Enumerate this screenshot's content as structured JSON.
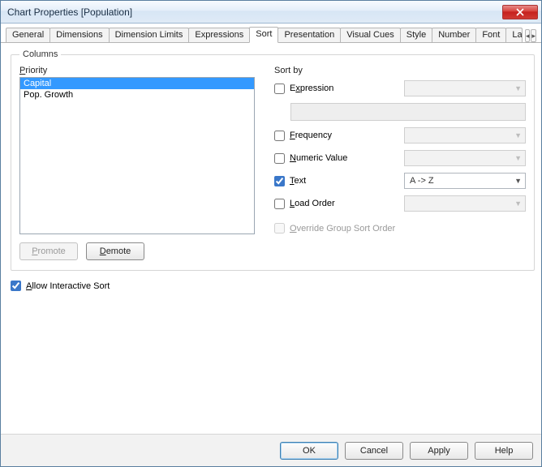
{
  "window": {
    "title": "Chart Properties [Population]"
  },
  "tabs": {
    "items": [
      "General",
      "Dimensions",
      "Dimension Limits",
      "Expressions",
      "Sort",
      "Presentation",
      "Visual Cues",
      "Style",
      "Number",
      "Font",
      "Layo"
    ],
    "activeIndex": 4
  },
  "columns": {
    "legend": "Columns",
    "priority_label": "Priority",
    "priority_items": [
      "Capital",
      "Pop. Growth"
    ],
    "selectedIndex": 0,
    "promote_label": "Promote",
    "demote_label": "Demote"
  },
  "sortby": {
    "label": "Sort by",
    "expression": {
      "label_pre": "E",
      "label_u": "x",
      "label_post": "pression",
      "checked": false,
      "combo": ""
    },
    "frequency": {
      "label_u": "F",
      "label_post": "requency",
      "checked": false,
      "combo": ""
    },
    "numeric": {
      "label_u": "N",
      "label_post": "umeric Value",
      "checked": false,
      "combo": ""
    },
    "text": {
      "label_u": "T",
      "label_post": "ext",
      "checked": true,
      "combo": "A -> Z"
    },
    "loadorder": {
      "label_u": "L",
      "label_post": "oad Order",
      "checked": false,
      "combo": ""
    },
    "override": {
      "label_u": "O",
      "label_post": "verride Group Sort Order",
      "checked": false
    }
  },
  "allow_interactive": {
    "label_u": "A",
    "label_post": "llow Interactive Sort",
    "checked": true
  },
  "footer": {
    "ok": "OK",
    "cancel": "Cancel",
    "apply": "Apply",
    "help": "Help"
  }
}
